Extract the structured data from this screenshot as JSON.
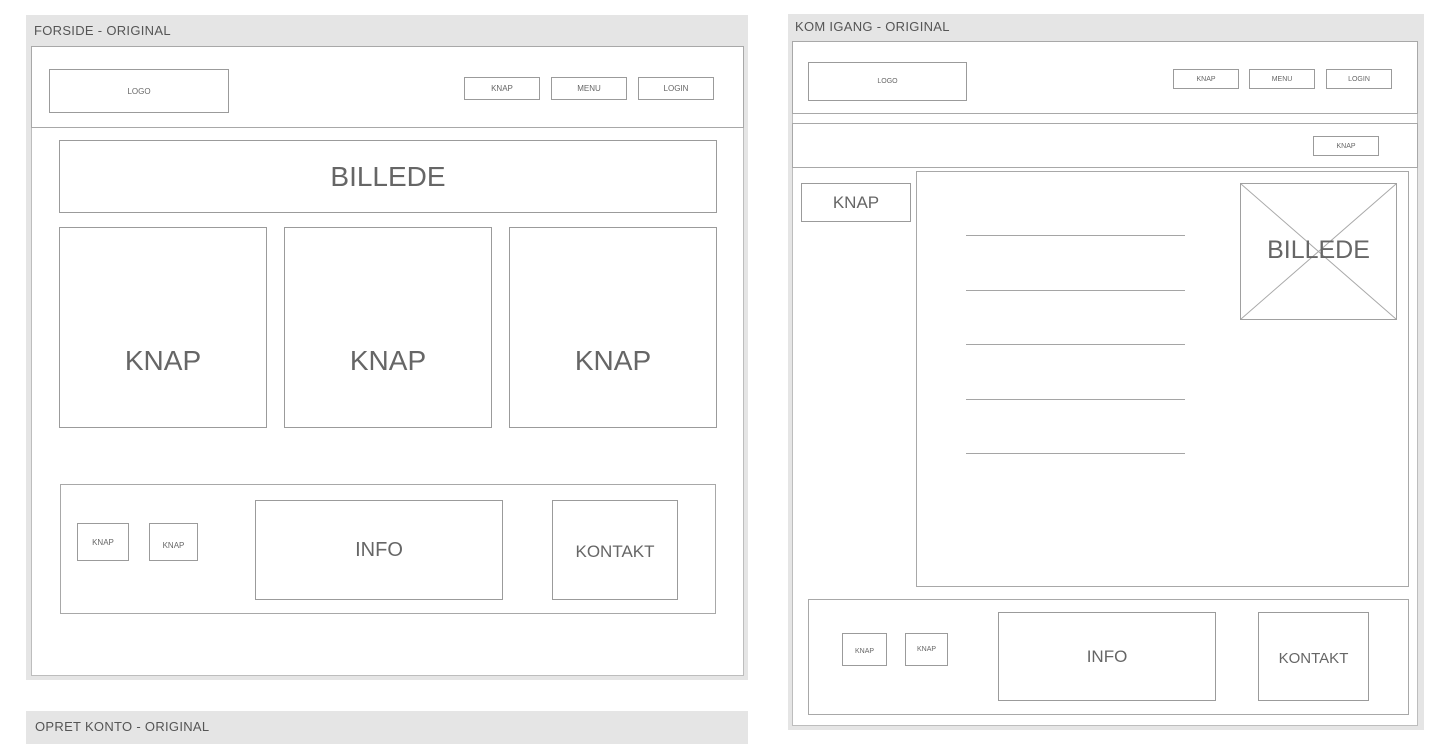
{
  "frames": {
    "forside": {
      "title": "FORSIDE - ORIGINAL",
      "header": {
        "logo": "LOGO",
        "nav": [
          "KNAP",
          "MENU",
          "LOGIN"
        ]
      },
      "banner": "BILLEDE",
      "tiles": [
        "KNAP",
        "KNAP",
        "KNAP"
      ],
      "footer": {
        "small_buttons": [
          "KNAP",
          "KNAP"
        ],
        "info": "INFO",
        "contact": "KONTAKT"
      }
    },
    "kom_igang": {
      "title": "KOM IGANG - ORIGINAL",
      "header": {
        "logo": "LOGO",
        "nav": [
          "KNAP",
          "MENU",
          "LOGIN"
        ]
      },
      "subbar_button": "KNAP",
      "side_button": "KNAP",
      "image_label": "BILLEDE",
      "footer": {
        "small_buttons": [
          "KNAP",
          "KNAP"
        ],
        "info": "INFO",
        "contact": "KONTAKT"
      }
    },
    "opret_konto": {
      "title": "OPRET KONTO - ORIGINAL"
    }
  },
  "colors": {
    "frame_bg": "#e5e5e5",
    "outline": "#9b9b9b",
    "text": "#666666"
  }
}
